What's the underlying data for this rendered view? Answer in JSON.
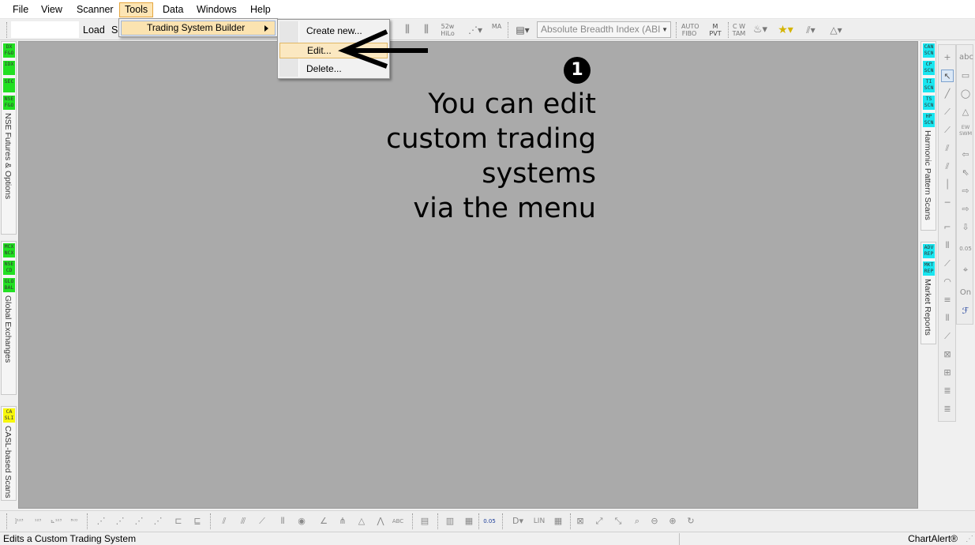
{
  "menubar": {
    "items": [
      "File",
      "View",
      "Scanner",
      "Tools",
      "Data",
      "Windows",
      "Help"
    ]
  },
  "toolbar": {
    "symbol_value": "",
    "load_label": "Load",
    "s_label": "S",
    "indicator_select": "Absolute Breadth Index (ABI",
    "icons": [
      "52w HiLo",
      "MA",
      "AUTO FIBO",
      "M PVT",
      "C W TAM",
      "T S"
    ]
  },
  "tools_menu": {
    "item": "Trading System Builder"
  },
  "trading_submenu": {
    "items": [
      "Create new...",
      "Edit...",
      "Delete..."
    ],
    "highlighted": "Edit..."
  },
  "annotation": {
    "step": "❶",
    "lines": [
      "You can edit",
      "custom trading systems",
      "via the menu"
    ]
  },
  "left_panel": {
    "group1": {
      "tiles": [
        "DX F&O",
        "IDX",
        "SEC",
        "NSE F&O"
      ],
      "label": "NSE Futures & Options"
    },
    "group2": {
      "tiles": [
        "MCX NCX",
        "NSE CD",
        "GLO BAL"
      ],
      "label": "Global Exchanges"
    },
    "group3": {
      "tiles": [
        "CA SLI"
      ],
      "label": "CASL-based Scans"
    }
  },
  "right_panel": {
    "group1": {
      "tiles": [
        "CAN SCN",
        "CP SCN",
        "TI SCN",
        "TS SCN",
        "HP SCN"
      ],
      "label": "Harmonic Pattern Scans"
    },
    "group2": {
      "tiles": [
        "ADV REP",
        "MKT REP"
      ],
      "label": "Market Reports"
    }
  },
  "draw_tools": {
    "labels": [
      "abc",
      "On",
      "EW SWM",
      "0.05"
    ]
  },
  "bottom_toolbar": {
    "labels": [
      "LIN",
      "ABC",
      "0.05"
    ]
  },
  "status_bar": {
    "text": "Edits a Custom Trading System",
    "brand": "ChartAlert®"
  },
  "colors": {
    "chart_bg": "#aaaaaa",
    "menu_highlight": "#fde5b4",
    "tile_green": "#22e022",
    "tile_yellow": "#f7f70a",
    "tile_cyan": "#19e6f0"
  }
}
